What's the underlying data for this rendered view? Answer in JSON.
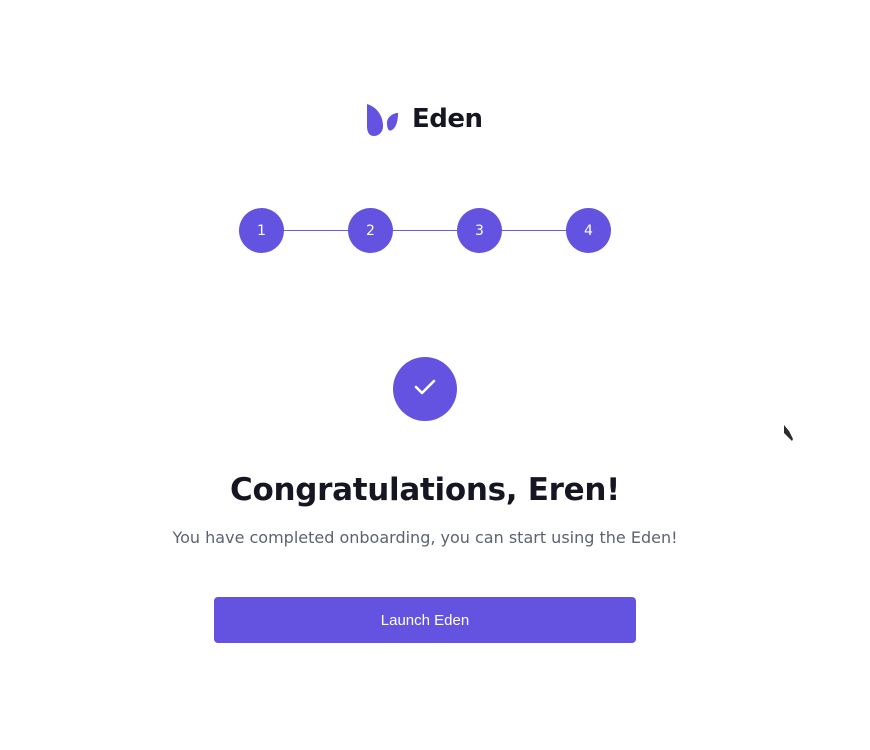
{
  "brand": {
    "name": "Eden",
    "accent_color": "#6353e0",
    "icon": "eden-leaf-logo-icon"
  },
  "stepper": {
    "steps": [
      {
        "label": "1",
        "state": "completed"
      },
      {
        "label": "2",
        "state": "completed"
      },
      {
        "label": "3",
        "state": "completed"
      },
      {
        "label": "4",
        "state": "completed"
      }
    ]
  },
  "success": {
    "icon": "checkmark-icon",
    "title": "Congratulations, Eren!",
    "message": "You have completed onboarding, you can start using the Eden!"
  },
  "actions": {
    "launch_label": "Launch Eden"
  }
}
